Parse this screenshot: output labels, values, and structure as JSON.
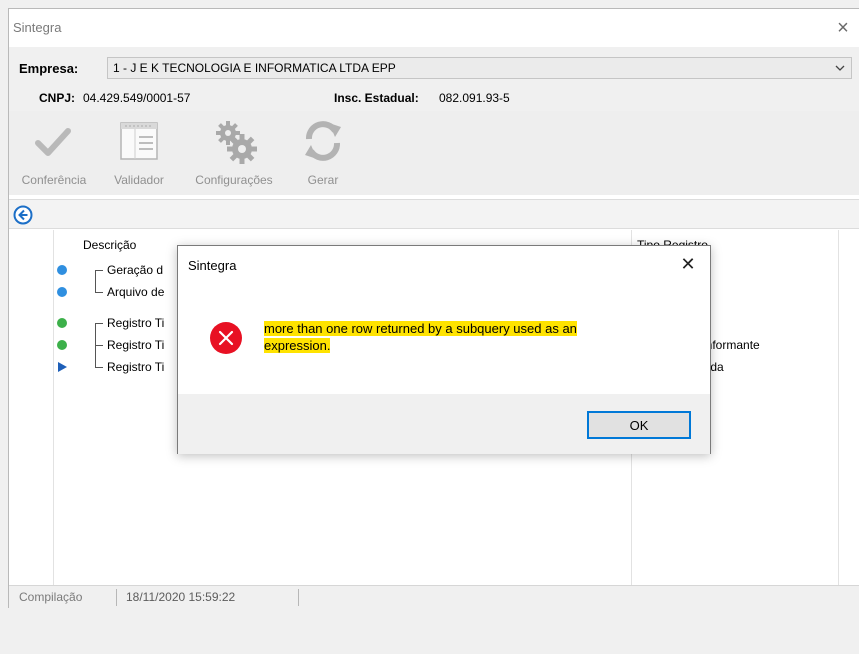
{
  "window": {
    "title": "Sintegra",
    "close_glyph": "×"
  },
  "empresa": {
    "label": "Empresa:",
    "value": "1 - J E K TECNOLOGIA E INFORMATICA LTDA EPP",
    "cnpj_label": "CNPJ:",
    "cnpj_value": "04.429.549/0001-57",
    "ie_label": "Insc. Estadual:",
    "ie_value": "082.091.93-5"
  },
  "toolbar": {
    "items": [
      {
        "label": "Conferência",
        "icon": "checkmark-icon"
      },
      {
        "label": "Validador",
        "icon": "validator-window-icon"
      },
      {
        "label": "Configurações",
        "icon": "gears-icon"
      },
      {
        "label": "Gerar",
        "icon": "refresh-icon"
      }
    ]
  },
  "nav": {
    "back_icon": "back-arrow-icon"
  },
  "grid": {
    "header_desc": "Descrição",
    "header_tipo": "Tipo Registro",
    "rows": [
      {
        "desc": "Geração d",
        "tipo": "",
        "marker": "dot",
        "color": "#2f8fe0"
      },
      {
        "desc": "Arquivo de",
        "tipo": "",
        "marker": "dot",
        "color": "#2f8fe0"
      },
      {
        "desc": "Registro Ti",
        "tipo": "",
        "marker": "dot",
        "color": "#3cb04a"
      },
      {
        "desc": "Registro Ti",
        "tipo": "to Informante",
        "marker": "dot",
        "color": "#3cb04a"
      },
      {
        "desc": "Registro Ti",
        "tipo": "/Saída",
        "marker": "triangle",
        "color": "#1e5fb8"
      }
    ]
  },
  "status": {
    "left": "Compilação",
    "right": "18/11/2020 15:59:22"
  },
  "dialog": {
    "title": "Sintegra",
    "close_glyph": "✕",
    "icon": "error-icon",
    "line1": "more than one row returned by a subquery used as an",
    "line2": "expression.",
    "ok_label": "OK",
    "highlight_color": "#ffe300",
    "error_color": "#e81123"
  }
}
